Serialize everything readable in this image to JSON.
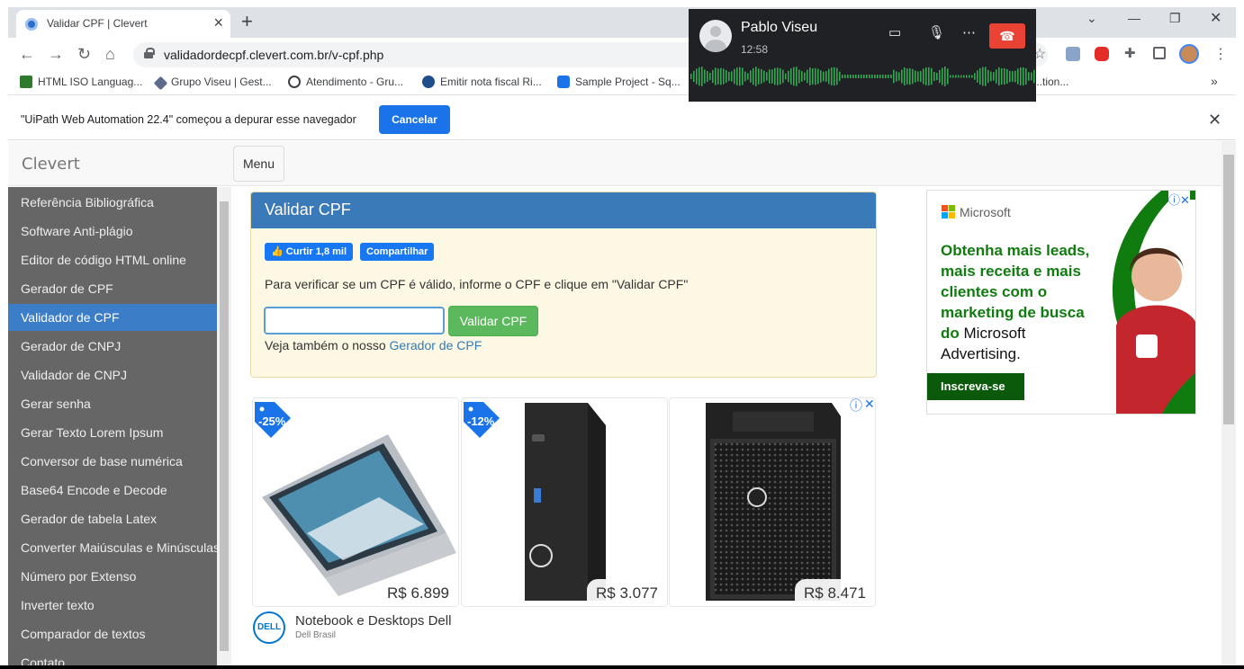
{
  "browser": {
    "tab_title": "Validar CPF | Clevert",
    "url": "validadordecpf.clevert.com.br/v-cpf.php",
    "bookmarks": [
      {
        "label": "HTML ISO Languag...",
        "color": "#2d7a2d"
      },
      {
        "label": "Grupo Viseu | Gest...",
        "color": "#5b6b8c"
      },
      {
        "label": "Atendimento - Gru...",
        "color": "#3c4043"
      },
      {
        "label": "Emitir nota fiscal Ri...",
        "color": "#1f4e8c"
      },
      {
        "label": "Sample Project - Sq...",
        "color": "#1a73e8"
      },
      {
        "label": "...tion...",
        "color": "#9aa0a6"
      }
    ],
    "bookmarks_more": "»"
  },
  "infobar": {
    "message": "\"UiPath Web Automation 22.4\" começou a depurar esse navegador",
    "cancel_label": "Cancelar"
  },
  "call": {
    "name": "Pablo Viseu",
    "duration": "12:58"
  },
  "site": {
    "brand": "Clevert",
    "menu_label": "Menu"
  },
  "sidebar": {
    "items": [
      {
        "label": "Referência Bibliográfica"
      },
      {
        "label": "Software Anti-plágio"
      },
      {
        "label": "Editor de código HTML online"
      },
      {
        "label": "Gerador de CPF"
      },
      {
        "label": "Validador de CPF",
        "active": true
      },
      {
        "label": "Gerador de CNPJ"
      },
      {
        "label": "Validador de CNPJ"
      },
      {
        "label": "Gerar senha"
      },
      {
        "label": "Gerar Texto Lorem Ipsum"
      },
      {
        "label": "Conversor de base numérica"
      },
      {
        "label": "Base64 Encode e Decode"
      },
      {
        "label": "Gerador de tabela Latex"
      },
      {
        "label": "Converter Maiúsculas e Minúsculas"
      },
      {
        "label": "Número por Extenso"
      },
      {
        "label": "Inverter texto"
      },
      {
        "label": "Comparador de textos"
      },
      {
        "label": "Contato"
      }
    ]
  },
  "validator": {
    "title": "Validar CPF",
    "like_label": "Curtir 1,8 mil",
    "share_label": "Compartilhar",
    "description": "Para verificar se um CPF é válido, informe o CPF e clique em \"Validar CPF\"",
    "input_value": "",
    "button_label": "Validar CPF",
    "see_also_prefix": "Veja também o nosso ",
    "see_also_link": "Gerador de CPF"
  },
  "dell_ad": {
    "products": [
      {
        "price": "R$ 6.899",
        "discount": "-25%"
      },
      {
        "price": "R$ 3.077",
        "discount": "-12%"
      },
      {
        "price": "R$ 8.471",
        "discount": ""
      }
    ],
    "brand_logo_text": "DELL",
    "advertiser": "Notebook e Desktops Dell",
    "advertiser_sub": "Dell Brasil"
  },
  "ms_ad": {
    "brand": "Microsoft",
    "headline_green": "Obtenha mais leads, mais receita e mais clientes com o marketing de busca do",
    "headline_dark": "Microsoft Advertising.",
    "cta": "Inscreva-se"
  }
}
